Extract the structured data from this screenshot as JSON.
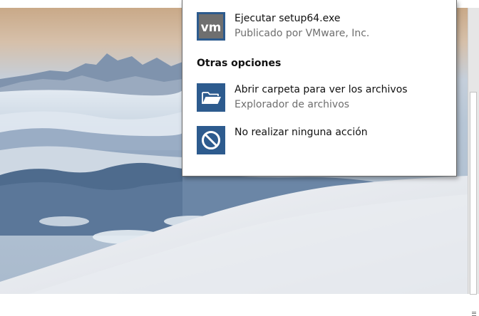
{
  "flyout": {
    "options": [
      {
        "title": "Ejecutar setup64.exe",
        "subtitle": "Publicado por VMware, Inc.",
        "icon": "vmware-icon"
      },
      {
        "title": "Abrir carpeta para ver los archivos",
        "subtitle": "Explorador de archivos",
        "icon": "folder-open-icon"
      },
      {
        "title": "No realizar ninguna acción",
        "icon": "no-action-icon"
      }
    ],
    "section_heading": "Otras opciones",
    "icon_tile_color": "#2d5b8e",
    "vmware_tile_color": "#6f6f6f"
  }
}
